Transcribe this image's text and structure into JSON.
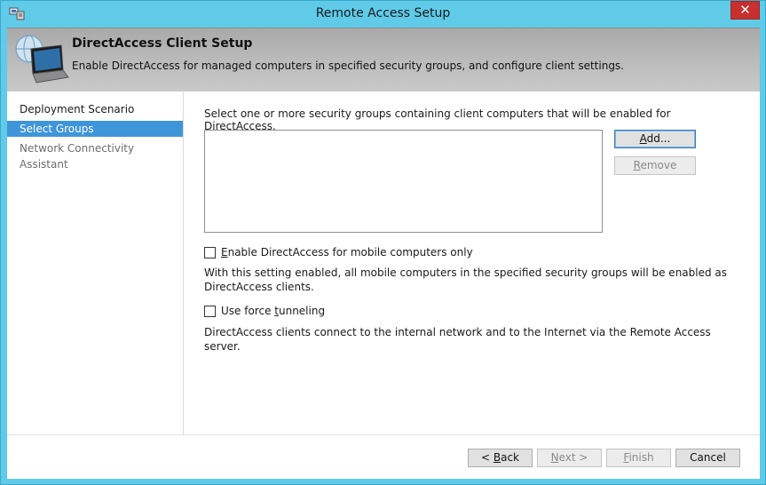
{
  "window": {
    "title": "Remote Access Setup",
    "close_glyph": "✕"
  },
  "header": {
    "title": "DirectAccess Client Setup",
    "description": "Enable DirectAccess for managed computers in specified security groups, and configure client settings."
  },
  "nav": {
    "items": [
      {
        "label": "Deployment Scenario",
        "state": "normal"
      },
      {
        "label": "Select Groups",
        "state": "active"
      },
      {
        "label": "Network Connectivity Assistant",
        "state": "disabled"
      }
    ]
  },
  "main": {
    "instruction": "Select one or more security groups containing client computers that will be enabled for DirectAccess.",
    "groups": [],
    "add_pre": "",
    "add_key": "A",
    "add_post": "dd...",
    "remove_pre": "",
    "remove_key": "R",
    "remove_post": "emove",
    "mobile": {
      "label_pre": "",
      "label_key": "E",
      "label_post": "nable DirectAccess for mobile computers only",
      "checked": false,
      "note": "With this setting enabled, all mobile computers in the specified security groups will be enabled as DirectAccess clients."
    },
    "force": {
      "label_pre": "Use force ",
      "label_key": "t",
      "label_post": "unneling",
      "checked": false,
      "note": "DirectAccess clients connect to the internal network and to the Internet via the Remote Access server."
    }
  },
  "footer": {
    "back_pre": "< ",
    "back_key": "B",
    "back_post": "ack",
    "next_pre": "",
    "next_key": "N",
    "next_post": "ext >",
    "finish_pre": "",
    "finish_key": "F",
    "finish_post": "inish",
    "cancel": "Cancel"
  },
  "colors": {
    "accent": "#3f95d9",
    "chrome": "#5fcbe9",
    "close": "#c7302e"
  }
}
